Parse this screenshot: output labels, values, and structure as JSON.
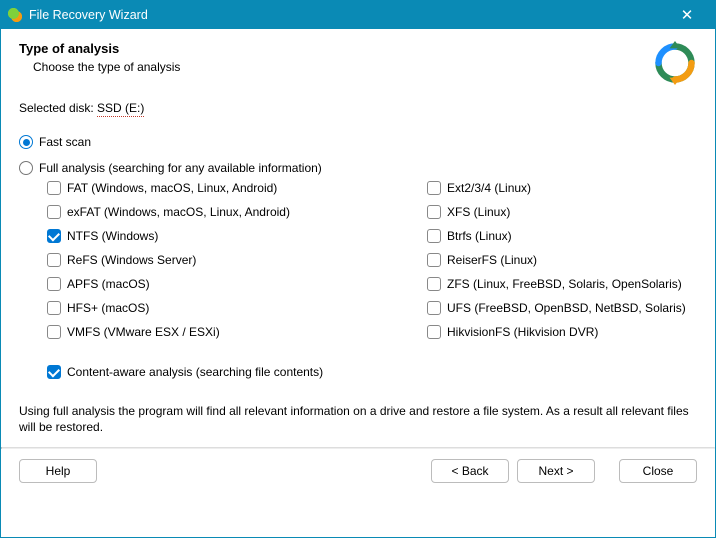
{
  "window": {
    "title": "File Recovery Wizard"
  },
  "header": {
    "title": "Type of analysis",
    "subtitle": "Choose the type of analysis"
  },
  "selected_disk": {
    "label": "Selected disk: ",
    "value": "SSD (E:)"
  },
  "analysis_modes": {
    "fast": {
      "label": "Fast scan",
      "checked": true
    },
    "full": {
      "label": "Full analysis (searching for any available information)",
      "checked": false
    }
  },
  "filesystems": {
    "left": [
      {
        "key": "fat",
        "label": "FAT (Windows, macOS, Linux, Android)",
        "checked": false
      },
      {
        "key": "exfat",
        "label": "exFAT (Windows, macOS, Linux, Android)",
        "checked": false
      },
      {
        "key": "ntfs",
        "label": "NTFS (Windows)",
        "checked": true
      },
      {
        "key": "refs",
        "label": "ReFS (Windows Server)",
        "checked": false
      },
      {
        "key": "apfs",
        "label": "APFS (macOS)",
        "checked": false
      },
      {
        "key": "hfs",
        "label": "HFS+ (macOS)",
        "checked": false
      },
      {
        "key": "vmfs",
        "label": "VMFS (VMware ESX / ESXi)",
        "checked": false
      }
    ],
    "right": [
      {
        "key": "ext",
        "label": "Ext2/3/4 (Linux)",
        "checked": false
      },
      {
        "key": "xfs",
        "label": "XFS (Linux)",
        "checked": false
      },
      {
        "key": "btrfs",
        "label": "Btrfs (Linux)",
        "checked": false
      },
      {
        "key": "reiser",
        "label": "ReiserFS (Linux)",
        "checked": false
      },
      {
        "key": "zfs",
        "label": "ZFS (Linux, FreeBSD, Solaris, OpenSolaris)",
        "checked": false
      },
      {
        "key": "ufs",
        "label": "UFS (FreeBSD, OpenBSD, NetBSD, Solaris)",
        "checked": false
      },
      {
        "key": "hikvision",
        "label": "HikvisionFS (Hikvision DVR)",
        "checked": false
      }
    ]
  },
  "content_aware": {
    "label": "Content-aware analysis (searching file contents)",
    "checked": true
  },
  "description": "Using full analysis the program will find all relevant information on a drive and restore a file system. As a result all relevant files will be restored.",
  "footer": {
    "help": "Help",
    "back": "< Back",
    "next": "Next >",
    "close": "Close"
  }
}
